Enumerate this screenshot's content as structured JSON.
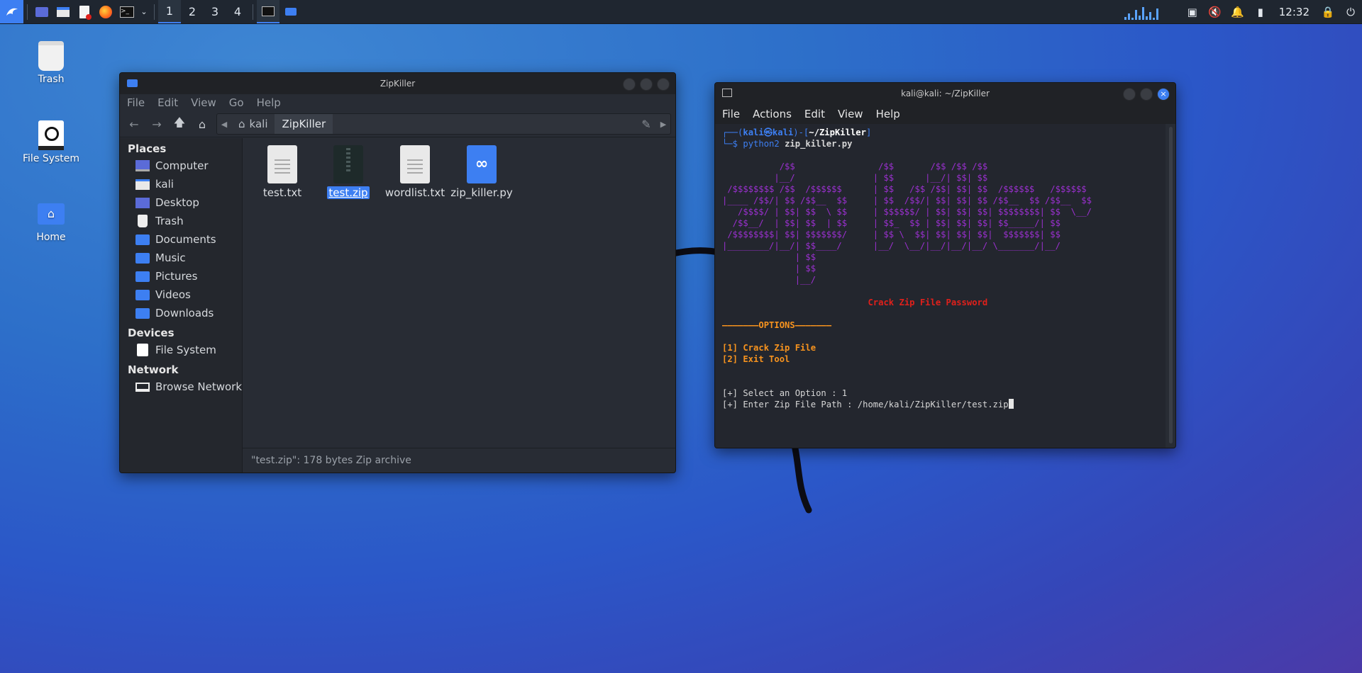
{
  "taskbar": {
    "workspaces": [
      "1",
      "2",
      "3",
      "4"
    ],
    "clock": "12:32"
  },
  "desktop": {
    "icons": [
      {
        "label": "Trash"
      },
      {
        "label": "File System"
      },
      {
        "label": "Home"
      }
    ]
  },
  "file_manager": {
    "title": "ZipKiller",
    "menu": [
      "File",
      "Edit",
      "View",
      "Go",
      "Help"
    ],
    "path": [
      "kali",
      "ZipKiller"
    ],
    "places_header": "Places",
    "places": [
      "Computer",
      "kali",
      "Desktop",
      "Trash",
      "Documents",
      "Music",
      "Pictures",
      "Videos",
      "Downloads"
    ],
    "devices_header": "Devices",
    "devices": [
      "File System"
    ],
    "network_header": "Network",
    "network": [
      "Browse Network"
    ],
    "files": [
      "test.txt",
      "test.zip",
      "wordlist.txt",
      "zip_killer.py"
    ],
    "selected_file": "test.zip",
    "status": "\"test.zip\": 178 bytes Zip archive"
  },
  "terminal": {
    "title": "kali@kali: ~/ZipKiller",
    "menu": [
      "File",
      "Actions",
      "Edit",
      "View",
      "Help"
    ],
    "prompt_user": "kali㉿kali",
    "prompt_dir": "~/ZipKiller",
    "command_bin": "python2",
    "command_arg": "zip_killer.py",
    "banner": [
      "           /$$                /$$       /$$ /$$ /$$",
      "          |__/               | $$      |__/| $$| $$",
      " /$$$$$$$$ /$$  /$$$$$$      | $$   /$$ /$$| $$| $$  /$$$$$$   /$$$$$$",
      "|____ /$$/| $$ /$$__  $$     | $$  /$$/| $$| $$| $$ /$$__  $$ /$$__  $$",
      "   /$$$$/ | $$| $$  \\ $$     | $$$$$$/ | $$| $$| $$| $$$$$$$$| $$  \\__/",
      "  /$$__/  | $$| $$  | $$     | $$_  $$ | $$| $$| $$| $$_____/| $$",
      " /$$$$$$$$| $$| $$$$$$$/     | $$ \\  $$| $$| $$| $$|  $$$$$$$| $$",
      "|________/|__/| $$____/      |__/  \\__/|__/|__/|__/ \\_______/|__/",
      "              | $$",
      "              | $$",
      "              |__/"
    ],
    "tagline": "Crack Zip File Password",
    "options_header": "———————OPTIONS———————",
    "options": [
      "[1] Crack Zip File",
      "[2] Exit Tool"
    ],
    "input_lines": [
      "[+] Select an Option : 1",
      "[+] Enter Zip File Path : /home/kali/ZipKiller/test.zip"
    ]
  }
}
